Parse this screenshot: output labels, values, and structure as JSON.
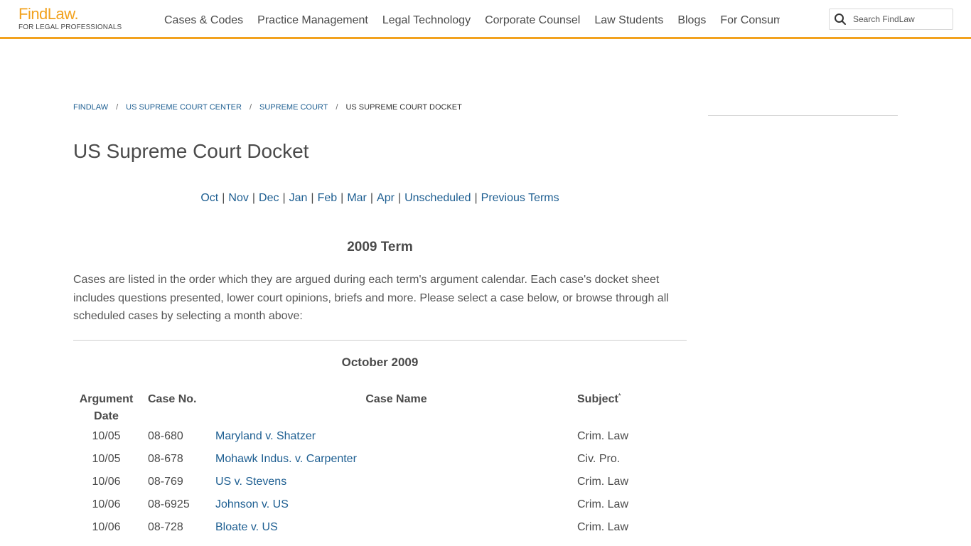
{
  "header": {
    "logo_main": "FindLaw.",
    "logo_sub": "FOR LEGAL PROFESSIONALS",
    "nav": [
      "Cases & Codes",
      "Practice Management",
      "Legal Technology",
      "Corporate Counsel",
      "Law Students",
      "Blogs",
      "For Consumers"
    ],
    "search_placeholder": "Search FindLaw",
    "accent_color": "#f2a21e"
  },
  "breadcrumb": {
    "items": [
      "FINDLAW",
      "US SUPREME COURT CENTER",
      "SUPREME COURT"
    ],
    "current": "US SUPREME COURT DOCKET",
    "separator": "/"
  },
  "page": {
    "title": "US Supreme Court Docket",
    "months": [
      "Oct",
      "Nov",
      "Dec",
      "Jan",
      "Feb",
      "Mar",
      "Apr",
      "Unscheduled",
      "Previous Terms"
    ],
    "month_sep": "|",
    "term_heading": "2009 Term",
    "intro": "Cases are listed in the order which they are argued during each term's argument calendar. Each case's docket sheet includes questions presented, lower court opinions, briefs and more. Please select a case below, or browse through all scheduled cases by selecting a month above:",
    "month_heading": "October 2009"
  },
  "table": {
    "headers": {
      "date_line1": "Argument",
      "date_line2": "Date",
      "case_no": "Case No.",
      "case_name": "Case Name",
      "subject": "Subject",
      "subject_marker": "*"
    },
    "rows": [
      {
        "date": "10/05",
        "no": "08-680",
        "name": "Maryland v. Shatzer",
        "subject": "Crim. Law"
      },
      {
        "date": "10/05",
        "no": "08-678",
        "name": "Mohawk Indus. v. Carpenter",
        "subject": "Civ. Pro."
      },
      {
        "date": "10/06",
        "no": "08-769",
        "name": "US v. Stevens",
        "subject": "Crim. Law"
      },
      {
        "date": "10/06",
        "no": "08-6925",
        "name": "Johnson v. US",
        "subject": "Crim. Law"
      },
      {
        "date": "10/06",
        "no": "08-728",
        "name": "Bloate v. US",
        "subject": "Crim. Law"
      }
    ]
  },
  "colors": {
    "link": "#1d5e91",
    "text": "#4a4a4a"
  }
}
